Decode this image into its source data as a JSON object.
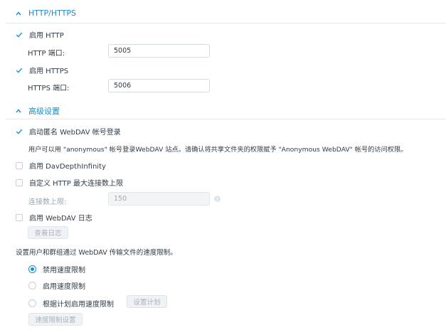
{
  "http_section": {
    "title": "HTTP/HTTPS",
    "enable_http_label": "启用 HTTP",
    "enable_http_checked": true,
    "http_port_label": "HTTP 端口:",
    "http_port_value": "5005",
    "enable_https_label": "启用 HTTPS",
    "enable_https_checked": true,
    "https_port_label": "HTTPS 端口:",
    "https_port_value": "5006"
  },
  "advanced_section": {
    "title": "高级设置",
    "anon_login_label": "启动匿名 WebDAV 帐号登录",
    "anon_login_checked": true,
    "anon_login_desc": "用户可以用 \"anonymous\" 帐号登录WebDAV 站点。请确认将共享文件夹的权限赋予 \"Anonymous WebDAV\" 帐号的访问权限。",
    "depth_infinity_label": "启用 DavDepthInfinity",
    "depth_infinity_checked": false,
    "custom_conn_label": "自定义 HTTP 最大连接数上限",
    "custom_conn_checked": false,
    "conn_limit_label": "连接数上限:",
    "conn_limit_value": "150",
    "enable_log_label": "启用 WebDAV 日志",
    "enable_log_checked": false,
    "view_log_button": "查看日志",
    "speed_desc": "设置用户和群组通过 WebDAV 传输文件的速度限制。",
    "speed_options": [
      {
        "label": "禁用速度限制",
        "selected": true
      },
      {
        "label": "启用速度限制",
        "selected": false
      },
      {
        "label": "根据计划启用速度限制",
        "selected": false
      }
    ],
    "schedule_button": "设置计划",
    "speed_settings_button": "速度限制设置"
  },
  "colors": {
    "accent": "#1a8ccd",
    "text": "#2f3b46",
    "disabled": "#a0a9b2"
  }
}
